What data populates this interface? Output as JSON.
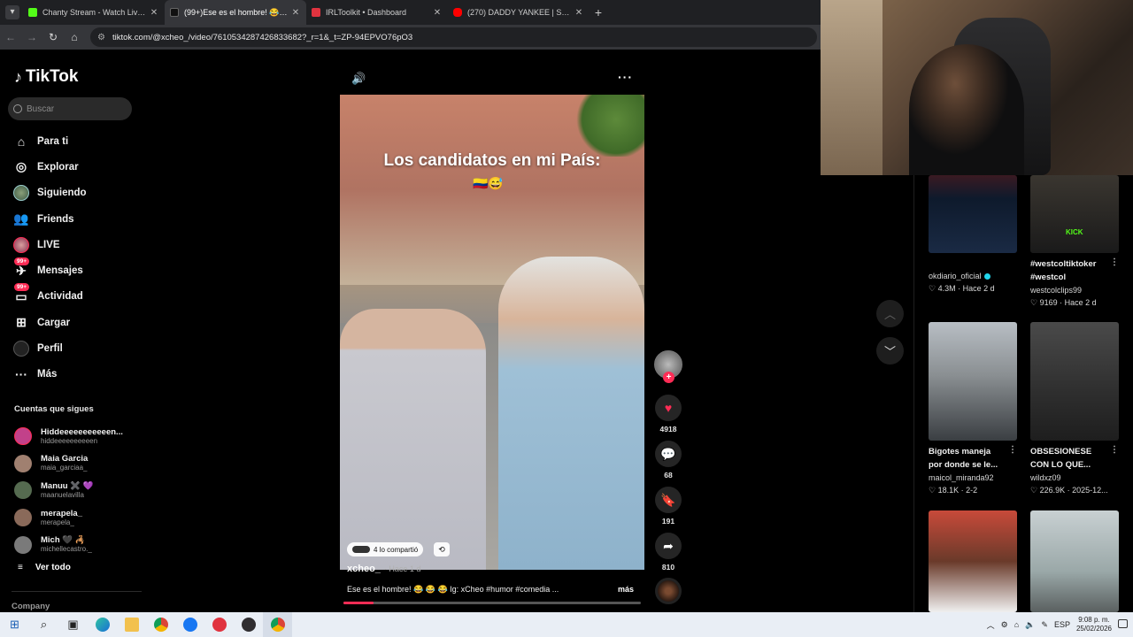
{
  "browser": {
    "tabs": [
      {
        "title": "Chanty Stream - Watch Live on",
        "favicon_color": "#53fc18",
        "active": false
      },
      {
        "title": "(99+)Ese es el hombre! 😂😂😂",
        "favicon_color": "#111111",
        "active": true
      },
      {
        "title": "IRLToolkit • Dashboard",
        "favicon_color": "#e0333f",
        "active": false
      },
      {
        "title": "(270) DADDY YANKEE | Somos",
        "favicon_color": "#ff0000",
        "active": false
      }
    ],
    "url": "tiktok.com/@xcheo_/video/7610534287426833682?_r=1&_t=ZP-94EPVO76pO3"
  },
  "tiktok": {
    "logo": "TikTok",
    "search_placeholder": "Buscar",
    "nav": [
      {
        "label": "Para ti",
        "icon": "home-icon",
        "badge": ""
      },
      {
        "label": "Explorar",
        "icon": "compass-icon",
        "badge": ""
      },
      {
        "label": "Siguiendo",
        "icon": "following-avatar-icon",
        "badge": ""
      },
      {
        "label": "Friends",
        "icon": "friends-icon",
        "badge": ""
      },
      {
        "label": "LIVE",
        "icon": "live-avatar-icon",
        "badge": ""
      },
      {
        "label": "Mensajes",
        "icon": "messages-icon",
        "badge": "99+"
      },
      {
        "label": "Actividad",
        "icon": "activity-icon",
        "badge": "99+"
      },
      {
        "label": "Cargar",
        "icon": "upload-icon",
        "badge": ""
      },
      {
        "label": "Perfil",
        "icon": "profile-icon",
        "badge": ""
      },
      {
        "label": "Más",
        "icon": "more-icon",
        "badge": ""
      }
    ],
    "following_title": "Cuentas que sigues",
    "following": [
      {
        "name": "Hiddeeeeeeeeeeen...",
        "username": "hiddeeeeeeeeeen",
        "color": "#c2418a"
      },
      {
        "name": "Maia Garcia",
        "username": "maia_garciaa_",
        "color": "#a08070"
      },
      {
        "name": "Manuu ✖️ 💜",
        "username": "maanuelavilla",
        "color": "#556b50"
      },
      {
        "name": "merapela_",
        "username": "merapela_",
        "color": "#8a6a5a"
      },
      {
        "name": "Mich 🖤 🦂",
        "username": "michellecastro._",
        "color": "#7a7a7a"
      }
    ],
    "see_all": "Ver todo",
    "company": "Company"
  },
  "video": {
    "overlay_title": "Los candidatos en mi País:",
    "overlay_emoji": "🇨🇴😅",
    "shared_text": "4 lo compartió",
    "author": "xcheo_",
    "posted": "· Hace 1 d",
    "caption": "Ese es el hombre! 😂 😂 😂 Ig: xCheo #humor #comedia ...",
    "more": "más",
    "progress": 0.1,
    "likes": "4918",
    "comments": "68",
    "saves": "191",
    "shares": "810"
  },
  "recommended": [
    {
      "title": "",
      "user": "okdiario_oficial",
      "verified": true,
      "likes": "4.3M",
      "age": "Hace 2 d",
      "bg": "#1a2230"
    },
    {
      "title": "#westcoltiktoker #westcol",
      "user": "westcolclips99",
      "verified": false,
      "likes": "9169",
      "age": "Hace 2 d",
      "bg": "#2b2a28",
      "thumb_text": "KICK"
    },
    {
      "title": "Bigotes maneja por donde se le...",
      "user": "maicol_miranda92",
      "verified": false,
      "likes": "18.1K",
      "age": "2-2",
      "bg": "#8a8f92"
    },
    {
      "title": "OBSESIONESE CON LO QUE...",
      "user": "wildxz09",
      "verified": false,
      "likes": "226.9K",
      "age": "2025-12...",
      "bg": "#3a3a3a"
    },
    {
      "title": "",
      "user": "",
      "verified": false,
      "likes": "",
      "age": "",
      "bg": "#c84a3a"
    },
    {
      "title": "",
      "user": "",
      "verified": false,
      "likes": "",
      "age": "",
      "bg": "#9aa8a8"
    }
  ],
  "taskbar": {
    "lang": "ESP",
    "time": "9:08 p. m.",
    "date": "25/02/2026"
  }
}
